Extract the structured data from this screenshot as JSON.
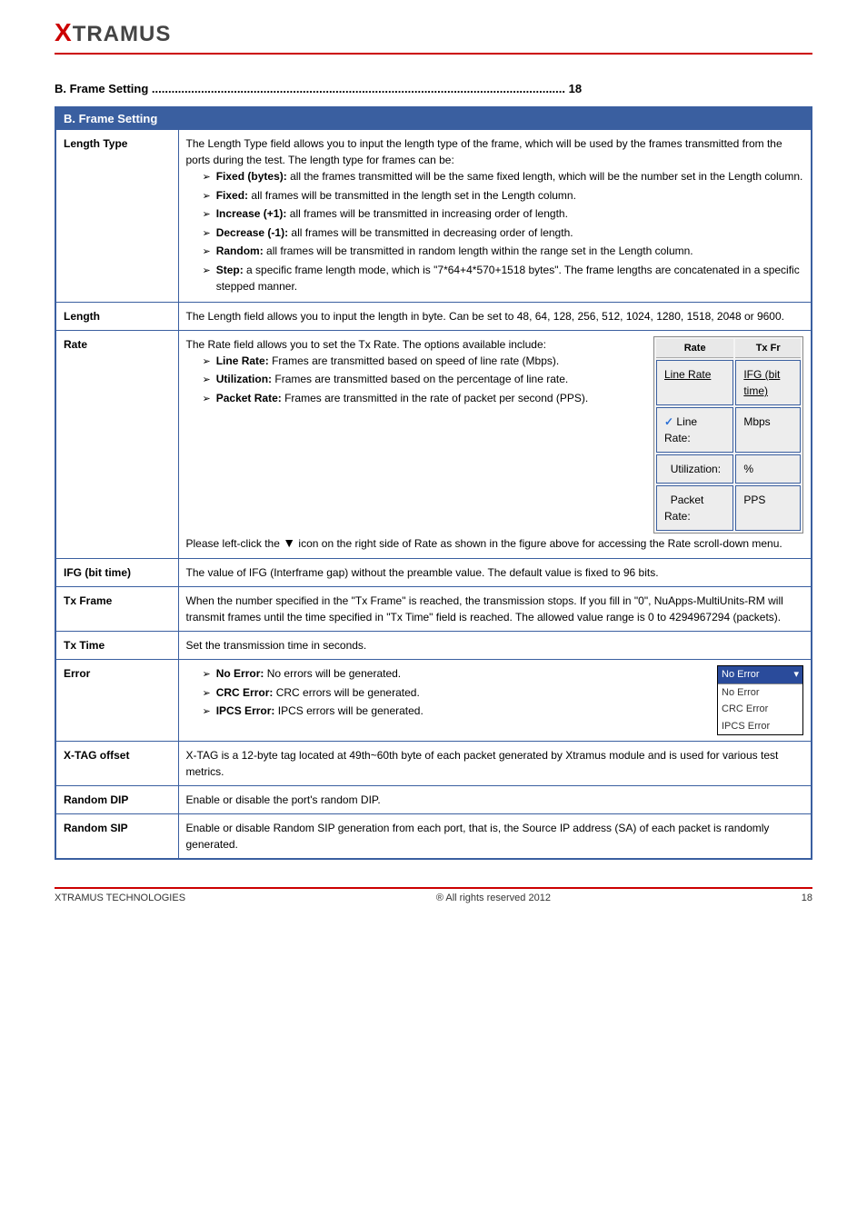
{
  "header": {
    "logo_x": "X",
    "logo_rest": "TRAMUS"
  },
  "toc": "B. Frame Setting .............................................................................................................................. 18",
  "table": {
    "title": "B. Frame Setting",
    "rows": {
      "length_type": {
        "label": "Length Type",
        "intro": "The Length Type field allows you to input the length type of the frame, which will be used by the frames transmitted from the ports during the test. The length type for frames can be:",
        "items": [
          {
            "b": "Fixed (bytes):",
            "t": " all the frames transmitted will be the same fixed length, which will be the number set in the Length column."
          },
          {
            "b": "Fixed:",
            "t": " all frames will be transmitted in the length set in the Length column."
          },
          {
            "b": "Increase (+1):",
            "t": " all frames will be transmitted in increasing order of length."
          },
          {
            "b": "Decrease (-1):",
            "t": " all frames will be transmitted in decreasing order of length."
          },
          {
            "b": "Random:",
            "t": " all frames will be transmitted in random length within the range set in the Length column."
          },
          {
            "b": "Step:",
            "t": " a specific frame length mode, which is \"7*64+4*570+1518 bytes\". The frame lengths are concatenated in a specific stepped manner."
          }
        ]
      },
      "length": {
        "label": "Length",
        "desc": "The Length field allows you to input the length in byte. Can be set to 48, 64, 128, 256, 512, 1024, 1280, 1518, 2048 or 9600."
      },
      "rate": {
        "label": "Rate",
        "intro": "The Rate field allows you to set the Tx Rate. The options available include:",
        "items": [
          {
            "b": "Line Rate:",
            "t": " Frames are transmitted based on speed of line rate (Mbps)."
          },
          {
            "b": "Utilization:",
            "t": " Frames are transmitted based on the percentage of line rate."
          },
          {
            "b": "Packet Rate:",
            "t": " Frames are transmitted in the rate of packet per second (PPS)."
          }
        ],
        "note_pre": "Please left-click the ",
        "note_post": " icon on the right side of Rate as shown in the figure above for accessing the Rate scroll-down menu.",
        "menu": {
          "h1": "Rate",
          "h2": "Tx Fr",
          "sub": "Line Rate",
          "sub2": "IFG (bit time)",
          "r1": "Line Rate:",
          "u1": "Mbps",
          "r2": "Utilization:",
          "u2": "%",
          "r3": "Packet Rate:",
          "u3": "PPS"
        }
      },
      "ifg": {
        "label": "IFG (bit time)",
        "desc": "The value of IFG (Interframe gap) without the preamble value. The default value is fixed to 96 bits."
      },
      "txframe": {
        "label": "Tx Frame",
        "desc": "When the number specified in the \"Tx Frame\" is reached, the transmission stops. If you fill in \"0\", NuApps-MultiUnits-RM will transmit frames until the time specified in \"Tx Time\" field is reached. The allowed value range is 0 to 4294967294 (packets)."
      },
      "txtime": {
        "label": "Tx Time",
        "desc": "Set the transmission time in seconds."
      },
      "error": {
        "label": "Error",
        "items": [
          {
            "b": "No Error:",
            "t": " No errors will be generated."
          },
          {
            "b": "CRC Error:",
            "t": " CRC errors will be generated."
          },
          {
            "b": "IPCS Error:",
            "t": " IPCS errors will be generated."
          }
        ],
        "menu": {
          "sel": "No Error",
          "o1": "No Error",
          "o2": "CRC Error",
          "o3": "IPCS Error"
        }
      },
      "xtag": {
        "label": "X-TAG offset",
        "desc": "X-TAG is a 12-byte tag located at 49th~60th byte of each packet generated by Xtramus module and is used for various test metrics."
      },
      "random_dip": {
        "label": "Random DIP",
        "desc": "Enable or disable the port's random DIP."
      },
      "random_sip": {
        "label": "Random SIP",
        "desc": "Enable or disable Random SIP generation from each port, that is, the Source IP address (SA) of each packet is randomly generated."
      }
    }
  },
  "footer": {
    "left": "XTRAMUS TECHNOLOGIES",
    "center": "® All rights reserved 2012",
    "right": "18"
  }
}
